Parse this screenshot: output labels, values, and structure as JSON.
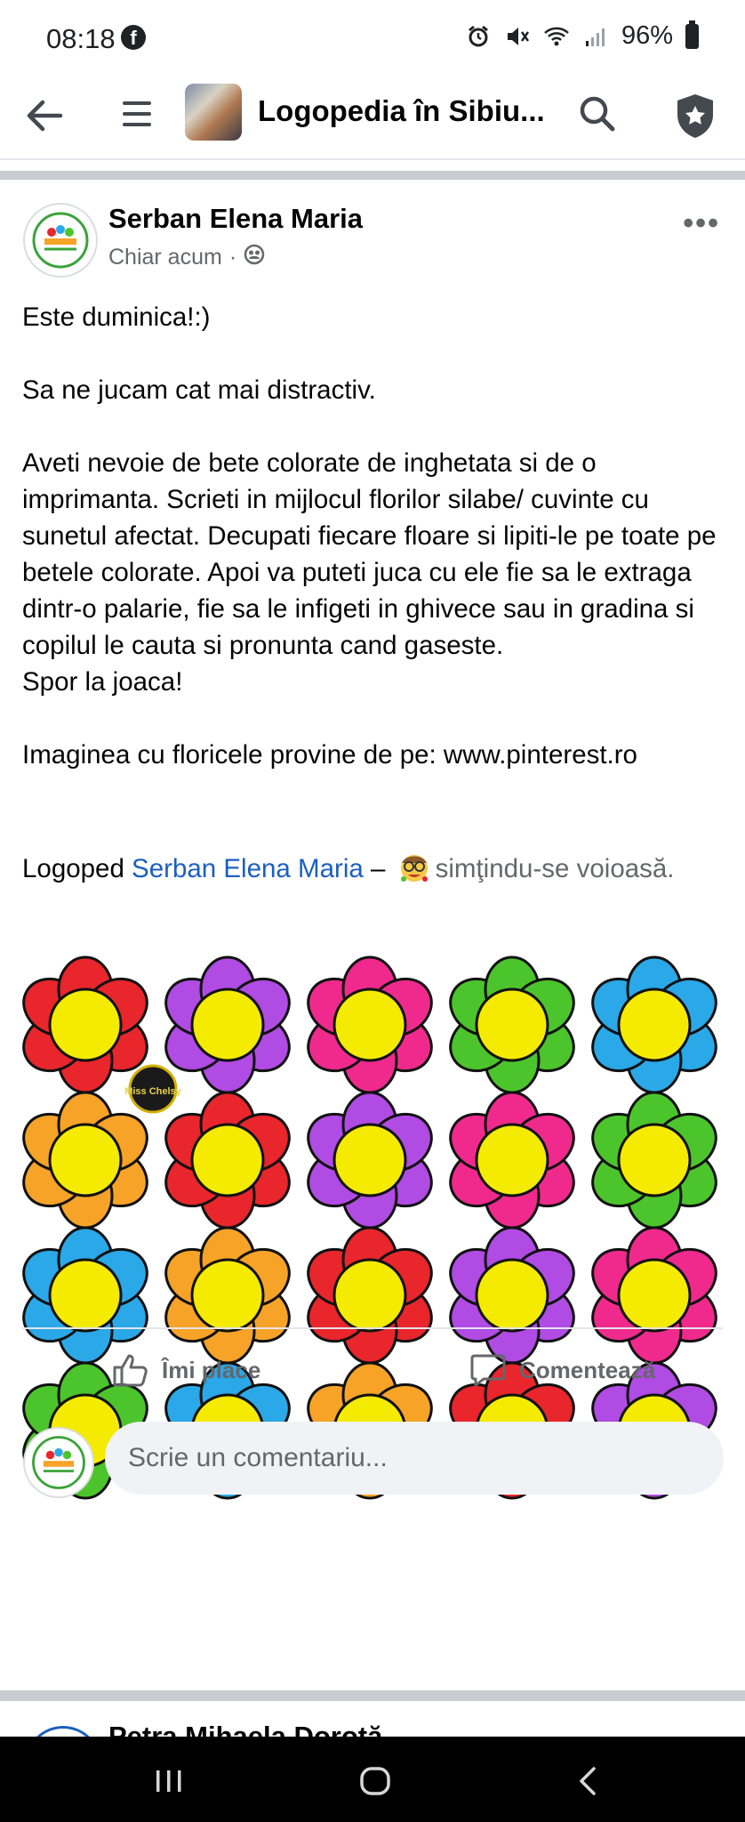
{
  "status_bar": {
    "time": "08:18",
    "battery": "96%"
  },
  "app_bar": {
    "title": "Logopedia în Sibiu..."
  },
  "post": {
    "author": "Serban Elena Maria",
    "timestamp": "Chiar acum",
    "paragraphs": [
      "Este duminica!:)",
      "Sa ne jucam cat mai distractiv.",
      "Aveti nevoie de bete colorate de inghetata si de o imprimanta. Scrieti in mijlocul florilor silabe/ cuvinte cu sunetul afectat. Decupati fiecare floare si lipiti-le pe toate pe betele colorate. Apoi va puteti juca cu ele fie sa le extraga dintr-o palarie, fie sa le infigeti in ghivece sau in gradina si copilul le cauta si pronunta cand gaseste.",
      "Spor la joaca!",
      "Imaginea cu floricele provine de pe: www.pinterest.ro"
    ],
    "tag_prefix": "Logoped ",
    "tagged_name": "Serban Elena Maria",
    "tag_dash": " – ",
    "feeling": "simţindu-se voioasă.",
    "image": {
      "watermark": "Miss Chelsy",
      "flower_rows": [
        [
          "#e8262c",
          "#b04be3",
          "#f02a8d",
          "#4cc52c",
          "#2aa8e8"
        ],
        [
          "#f6a328",
          "#e8262c",
          "#b04be3",
          "#f02a8d",
          "#4cc52c"
        ],
        [
          "#2aa8e8",
          "#f6a328",
          "#e8262c",
          "#b04be3",
          "#f02a8d"
        ],
        [
          "#4cc52c",
          "#2aa8e8",
          "#f6a328",
          "#e8262c",
          "#b04be3"
        ]
      ],
      "center_color": "#f5eb00"
    },
    "actions": {
      "like": "Îmi place",
      "comment": "Comentează"
    },
    "comment_placeholder": "Scrie un comentariu..."
  },
  "next_post": {
    "author": "Petra Mihaela Doroţă"
  },
  "colors": {
    "link": "#1b5fbf",
    "secondary_text": "#65676b",
    "separator": "#c9ccd1"
  }
}
